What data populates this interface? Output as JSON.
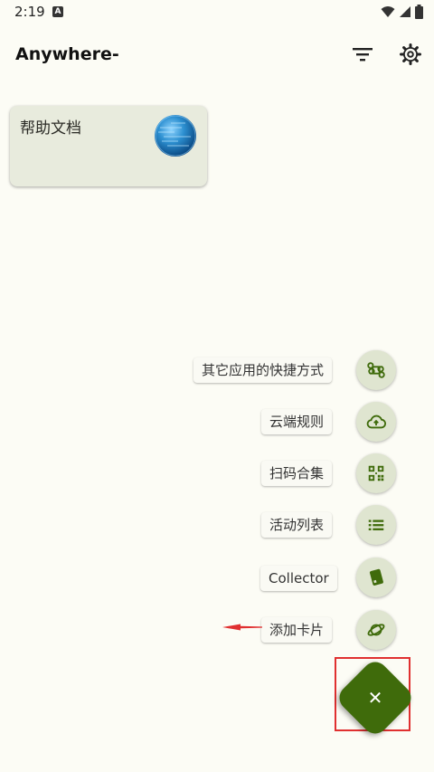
{
  "status_bar": {
    "time": "2:19",
    "notification_letter": "A",
    "icons": [
      "wifi-icon",
      "signal-icon",
      "battery-icon"
    ]
  },
  "app_bar": {
    "title": "Anywhere-",
    "actions": [
      "filter-icon",
      "gear-icon"
    ]
  },
  "cards": [
    {
      "title": "帮助文档",
      "icon": "globe-icon"
    }
  ],
  "fab_menu": {
    "items": [
      {
        "label": "其它应用的快捷方式",
        "icon": "command-icon"
      },
      {
        "label": "云端规则",
        "icon": "cloud-upload-icon"
      },
      {
        "label": "扫码合集",
        "icon": "qr-code-icon"
      },
      {
        "label": "活动列表",
        "icon": "list-icon"
      },
      {
        "label": "Collector",
        "icon": "collector-card-icon"
      },
      {
        "label": "添加卡片",
        "icon": "planet-icon"
      }
    ],
    "main_button_icon": "close-icon",
    "main_button_glyph": "✕"
  },
  "colors": {
    "background": "#fcfcf5",
    "card": "#e8ebdd",
    "mini_fab": "#dfe5d0",
    "primary": "#3f6b0b",
    "annotation": "#e03030"
  }
}
